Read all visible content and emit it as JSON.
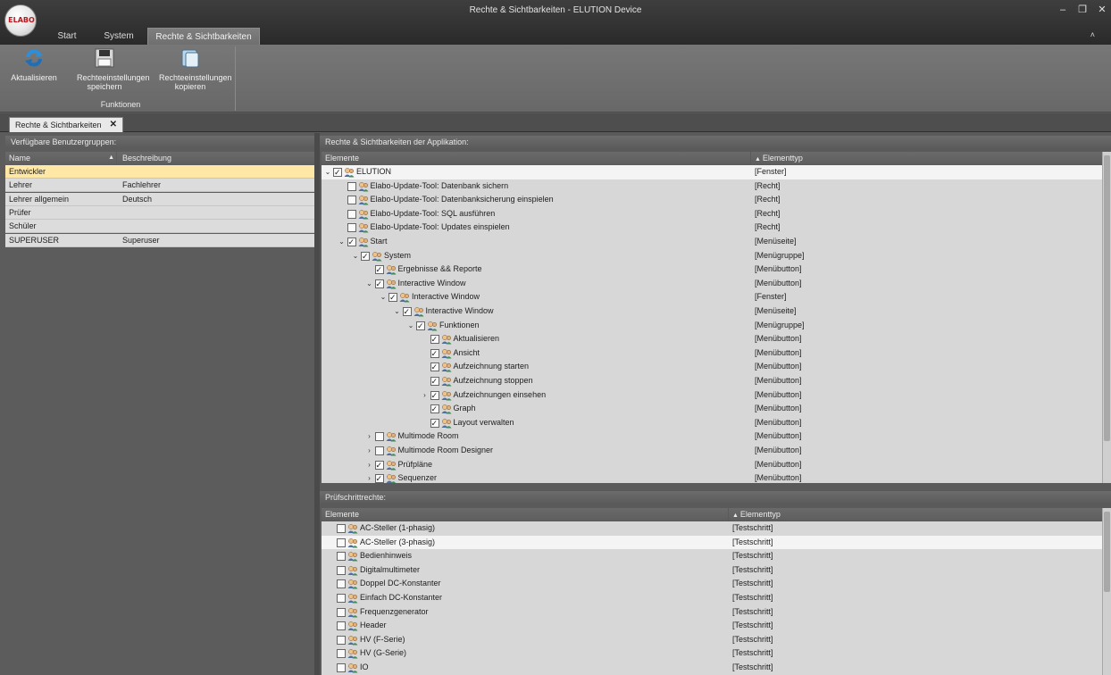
{
  "window": {
    "title": "Rechte & Sichtbarkeiten - ELUTION Device",
    "logo_text": "ELABO",
    "minimize": "–",
    "restore": "❐",
    "close": "✕"
  },
  "ribbon": {
    "tabs": [
      "Start",
      "System",
      "Rechte & Sichtbarkeiten"
    ],
    "active_tab": 2,
    "collapse": "˄",
    "buttons": [
      {
        "label": "Aktualisieren",
        "icon": "refresh-icon"
      },
      {
        "label": "Rechteeinstellungen speichern",
        "icon": "save-icon"
      },
      {
        "label": "Rechteeinstellungen kopieren",
        "icon": "copy-icon"
      }
    ],
    "group_label": "Funktionen"
  },
  "doc_tab": {
    "label": "Rechte & Sichtbarkeiten",
    "close": "✕"
  },
  "groups_panel": {
    "title": "Verfügbare Benutzergruppen:",
    "columns": [
      "Name",
      "Beschreibung"
    ],
    "rows": [
      {
        "name": "Entwickler",
        "desc": "",
        "selected": true
      },
      {
        "name": "Lehrer",
        "desc": "Fachlehrer"
      },
      {
        "name": "Lehrer allgemein",
        "desc": "Deutsch"
      },
      {
        "name": "Prüfer",
        "desc": ""
      },
      {
        "name": "Schüler",
        "desc": ""
      },
      {
        "name": "SUPERUSER",
        "desc": "Superuser"
      }
    ]
  },
  "rights_panel": {
    "title": "Rechte & Sichtbarkeiten der Applikation:",
    "columns": [
      "Elemente",
      "Elementtyp"
    ],
    "rows": [
      {
        "level": 0,
        "arrow": "⌄",
        "checked": true,
        "label": "ELUTION",
        "type": "[Fenster]",
        "selected": true,
        "icon": "user-group-icon"
      },
      {
        "level": 1,
        "arrow": "",
        "checked": false,
        "label": "Elabo-Update-Tool: Datenbank sichern",
        "type": "[Recht]",
        "icon": "key-user-icon"
      },
      {
        "level": 1,
        "arrow": "",
        "checked": false,
        "label": "Elabo-Update-Tool: Datenbanksicherung einspielen",
        "type": "[Recht]",
        "icon": "key-user-icon"
      },
      {
        "level": 1,
        "arrow": "",
        "checked": false,
        "label": "Elabo-Update-Tool: SQL ausführen",
        "type": "[Recht]",
        "icon": "key-user-icon"
      },
      {
        "level": 1,
        "arrow": "",
        "checked": false,
        "label": "Elabo-Update-Tool: Updates einspielen",
        "type": "[Recht]",
        "icon": "key-user-icon"
      },
      {
        "level": 1,
        "arrow": "⌄",
        "checked": true,
        "label": "Start",
        "type": "[Menüseite]",
        "icon": "user-group-icon"
      },
      {
        "level": 2,
        "arrow": "⌄",
        "checked": true,
        "label": "System",
        "type": "[Menügruppe]",
        "icon": "user-group-icon"
      },
      {
        "level": 3,
        "arrow": "",
        "checked": true,
        "label": "Ergebnisse && Reporte",
        "type": "[Menübutton]",
        "icon": "user-group-icon"
      },
      {
        "level": 3,
        "arrow": "⌄",
        "checked": true,
        "label": "Interactive Window",
        "type": "[Menübutton]",
        "icon": "user-group-icon"
      },
      {
        "level": 4,
        "arrow": "⌄",
        "checked": true,
        "label": "Interactive Window",
        "type": "[Fenster]",
        "icon": "user-group-icon"
      },
      {
        "level": 5,
        "arrow": "⌄",
        "checked": true,
        "label": "Interactive Window",
        "type": "[Menüseite]",
        "icon": "user-group-icon"
      },
      {
        "level": 6,
        "arrow": "⌄",
        "checked": true,
        "label": "Funktionen",
        "type": "[Menügruppe]",
        "icon": "user-group-icon"
      },
      {
        "level": 7,
        "arrow": "",
        "checked": true,
        "label": "Aktualisieren",
        "type": "[Menübutton]",
        "icon": "user-group-icon"
      },
      {
        "level": 7,
        "arrow": "",
        "checked": true,
        "label": "Ansicht",
        "type": "[Menübutton]",
        "icon": "user-group-icon"
      },
      {
        "level": 7,
        "arrow": "",
        "checked": true,
        "label": "Aufzeichnung starten",
        "type": "[Menübutton]",
        "icon": "user-group-icon"
      },
      {
        "level": 7,
        "arrow": "",
        "checked": true,
        "label": "Aufzeichnung stoppen",
        "type": "[Menübutton]",
        "icon": "user-group-icon"
      },
      {
        "level": 7,
        "arrow": "›",
        "checked": true,
        "label": "Aufzeichnungen einsehen",
        "type": "[Menübutton]",
        "icon": "user-group-icon"
      },
      {
        "level": 7,
        "arrow": "",
        "checked": true,
        "label": "Graph",
        "type": "[Menübutton]",
        "icon": "user-group-icon"
      },
      {
        "level": 7,
        "arrow": "",
        "checked": true,
        "label": "Layout verwalten",
        "type": "[Menübutton]",
        "icon": "user-group-icon"
      },
      {
        "level": 3,
        "arrow": "›",
        "checked": false,
        "label": "Multimode Room",
        "type": "[Menübutton]",
        "icon": "user-group-icon"
      },
      {
        "level": 3,
        "arrow": "›",
        "checked": false,
        "label": "Multimode Room Designer",
        "type": "[Menübutton]",
        "icon": "user-group-icon"
      },
      {
        "level": 3,
        "arrow": "›",
        "checked": true,
        "label": "Prüfpläne",
        "type": "[Menübutton]",
        "icon": "user-group-icon"
      },
      {
        "level": 3,
        "arrow": "›",
        "checked": true,
        "label": "Sequenzer",
        "type": "[Menübutton]",
        "icon": "user-group-icon"
      }
    ]
  },
  "steps_panel": {
    "title": "Prüfschrittrechte:",
    "columns": [
      "Elemente",
      "Elementtyp"
    ],
    "rows": [
      {
        "label": "AC-Steller (1-phasig)",
        "type": "[Testschritt]"
      },
      {
        "label": "AC-Steller (3-phasig)",
        "type": "[Testschritt]",
        "selected": true
      },
      {
        "label": "Bedienhinweis",
        "type": "[Testschritt]"
      },
      {
        "label": "Digitalmultimeter",
        "type": "[Testschritt]"
      },
      {
        "label": "Doppel DC-Konstanter",
        "type": "[Testschritt]"
      },
      {
        "label": "Einfach DC-Konstanter",
        "type": "[Testschritt]"
      },
      {
        "label": "Frequenzgenerator",
        "type": "[Testschritt]"
      },
      {
        "label": "Header",
        "type": "[Testschritt]"
      },
      {
        "label": "HV (F-Serie)",
        "type": "[Testschritt]"
      },
      {
        "label": "HV (G-Serie)",
        "type": "[Testschritt]"
      },
      {
        "label": "IO",
        "type": "[Testschritt]"
      }
    ]
  },
  "colors": {
    "accent": "#ffe8a6",
    "panel": "#dcdcdc",
    "dark": "#5a5a5a"
  }
}
